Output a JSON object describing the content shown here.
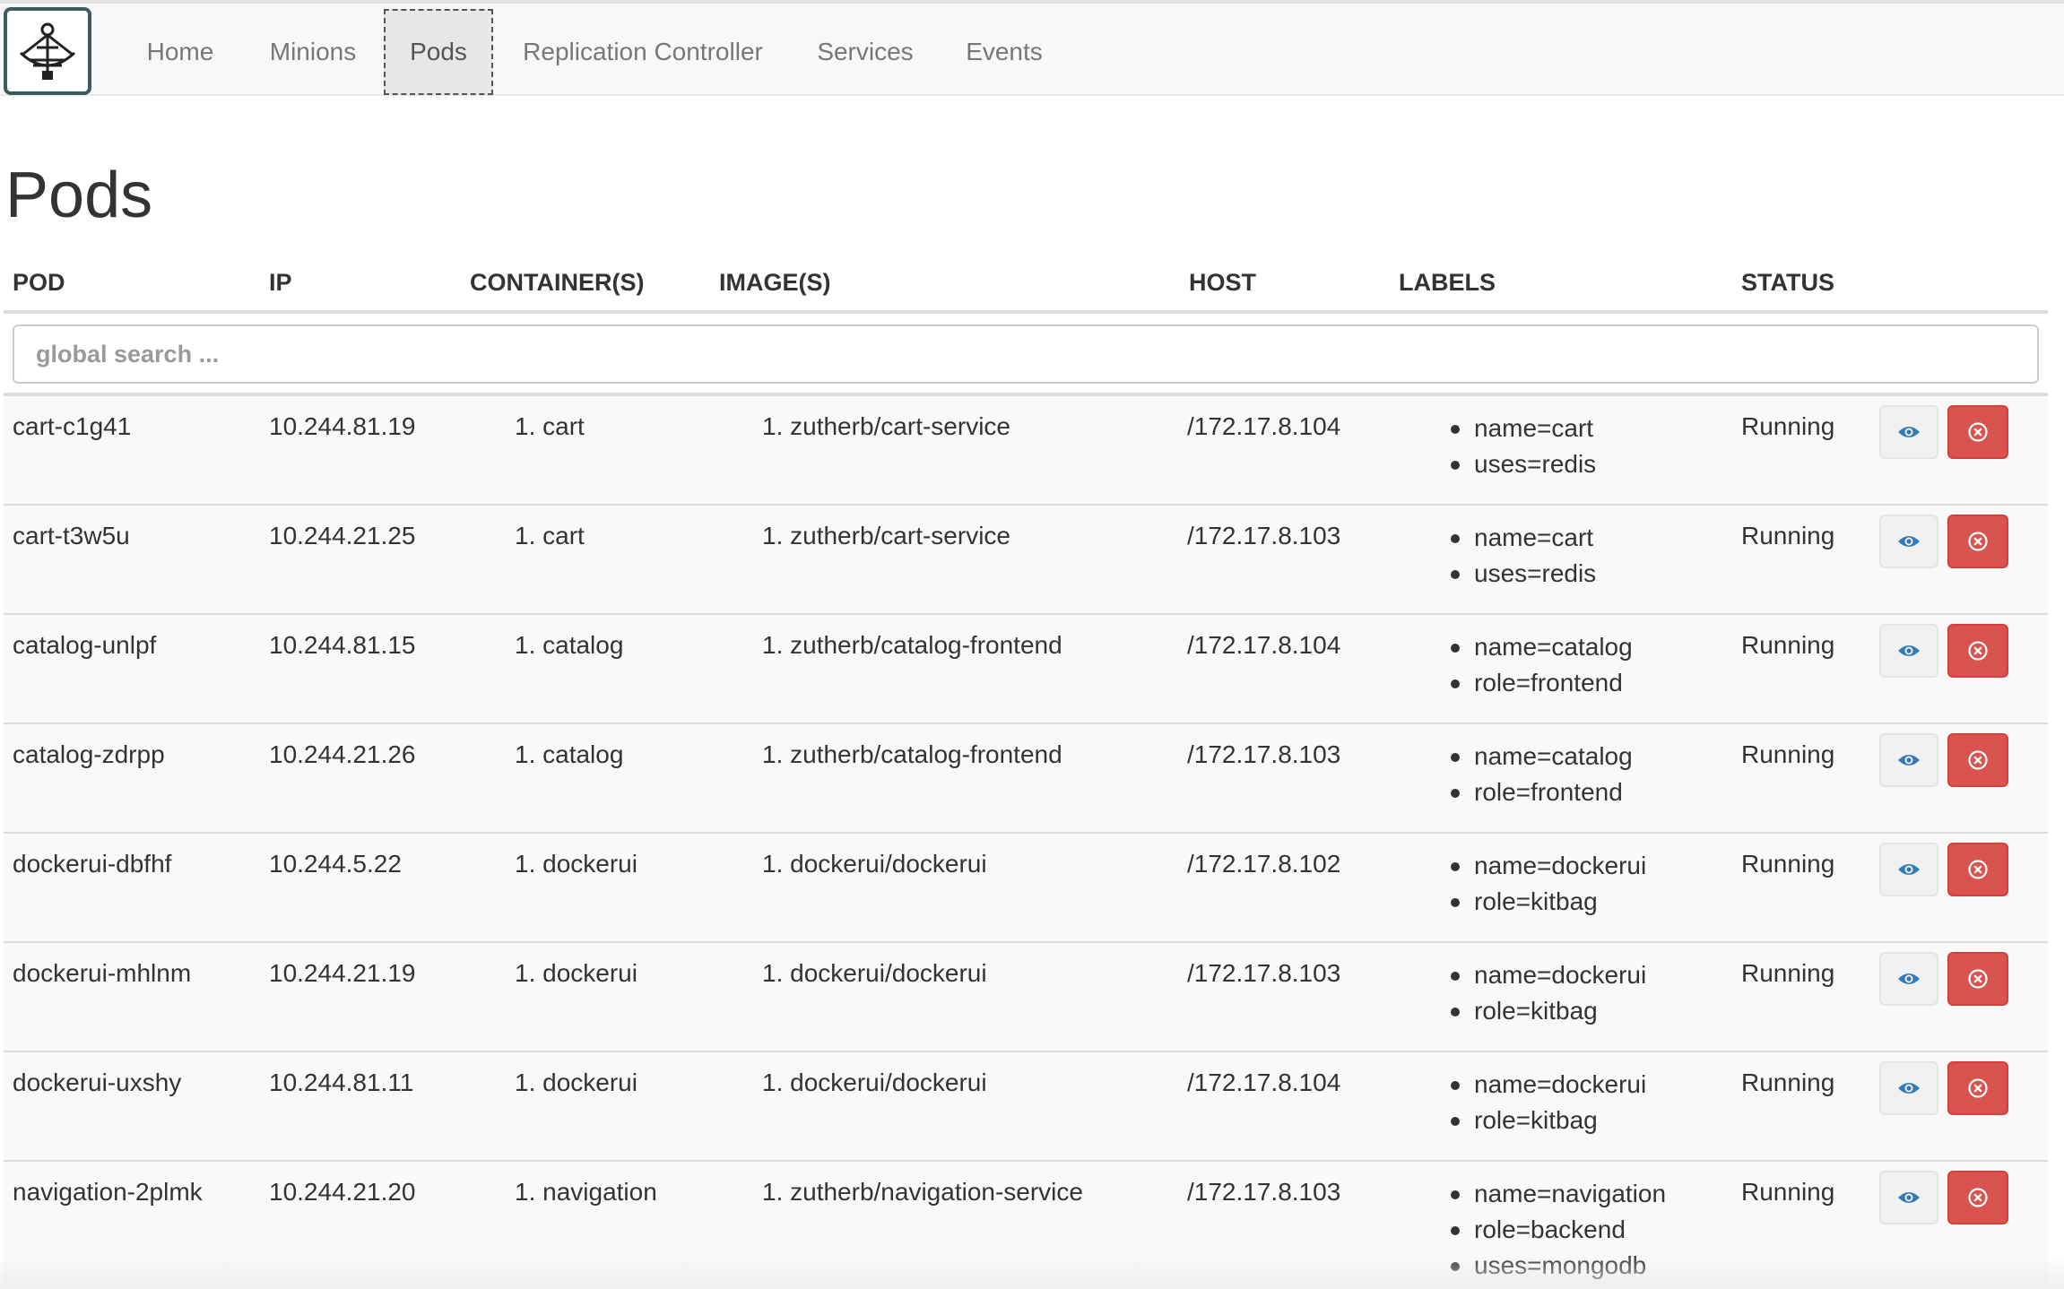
{
  "nav": {
    "items": [
      {
        "label": "Home"
      },
      {
        "label": "Minions"
      },
      {
        "label": "Pods",
        "active": true
      },
      {
        "label": "Replication Controller"
      },
      {
        "label": "Services"
      },
      {
        "label": "Events"
      }
    ]
  },
  "page": {
    "title": "Pods"
  },
  "table": {
    "headers": {
      "pod": "POD",
      "ip": "IP",
      "containers": "CONTAINER(S)",
      "images": "IMAGE(S)",
      "host": "HOST",
      "labels": "LABELS",
      "status": "STATUS"
    },
    "search_placeholder": "global search ...",
    "rows": [
      {
        "pod": "cart-c1g41",
        "ip": "10.244.81.19",
        "container": "1. cart",
        "image": "1. zutherb/cart-service",
        "host": "/172.17.8.104",
        "labels": [
          "name=cart",
          "uses=redis"
        ],
        "status": "Running"
      },
      {
        "pod": "cart-t3w5u",
        "ip": "10.244.21.25",
        "container": "1. cart",
        "image": "1. zutherb/cart-service",
        "host": "/172.17.8.103",
        "labels": [
          "name=cart",
          "uses=redis"
        ],
        "status": "Running"
      },
      {
        "pod": "catalog-unlpf",
        "ip": "10.244.81.15",
        "container": "1. catalog",
        "image": "1. zutherb/catalog-frontend",
        "host": "/172.17.8.104",
        "labels": [
          "name=catalog",
          "role=frontend"
        ],
        "status": "Running"
      },
      {
        "pod": "catalog-zdrpp",
        "ip": "10.244.21.26",
        "container": "1. catalog",
        "image": "1. zutherb/catalog-frontend",
        "host": "/172.17.8.103",
        "labels": [
          "name=catalog",
          "role=frontend"
        ],
        "status": "Running"
      },
      {
        "pod": "dockerui-dbfhf",
        "ip": "10.244.5.22",
        "container": "1. dockerui",
        "image": "1. dockerui/dockerui",
        "host": "/172.17.8.102",
        "labels": [
          "name=dockerui",
          "role=kitbag"
        ],
        "status": "Running"
      },
      {
        "pod": "dockerui-mhlnm",
        "ip": "10.244.21.19",
        "container": "1. dockerui",
        "image": "1. dockerui/dockerui",
        "host": "/172.17.8.103",
        "labels": [
          "name=dockerui",
          "role=kitbag"
        ],
        "status": "Running"
      },
      {
        "pod": "dockerui-uxshy",
        "ip": "10.244.81.11",
        "container": "1. dockerui",
        "image": "1. dockerui/dockerui",
        "host": "/172.17.8.104",
        "labels": [
          "name=dockerui",
          "role=kitbag"
        ],
        "status": "Running"
      },
      {
        "pod": "navigation-2plmk",
        "ip": "10.244.21.20",
        "container": "1. navigation",
        "image": "1. zutherb/navigation-service",
        "host": "/172.17.8.103",
        "labels": [
          "name=navigation",
          "role=backend",
          "uses=mongodb"
        ],
        "status": "Running"
      }
    ]
  },
  "icons": {
    "view": "eye-icon",
    "delete": "remove-circle-icon",
    "logo": "sextant-logo"
  },
  "colors": {
    "danger": "#d9534f",
    "link": "#337ab7",
    "navbar": "#f8f8f8"
  }
}
